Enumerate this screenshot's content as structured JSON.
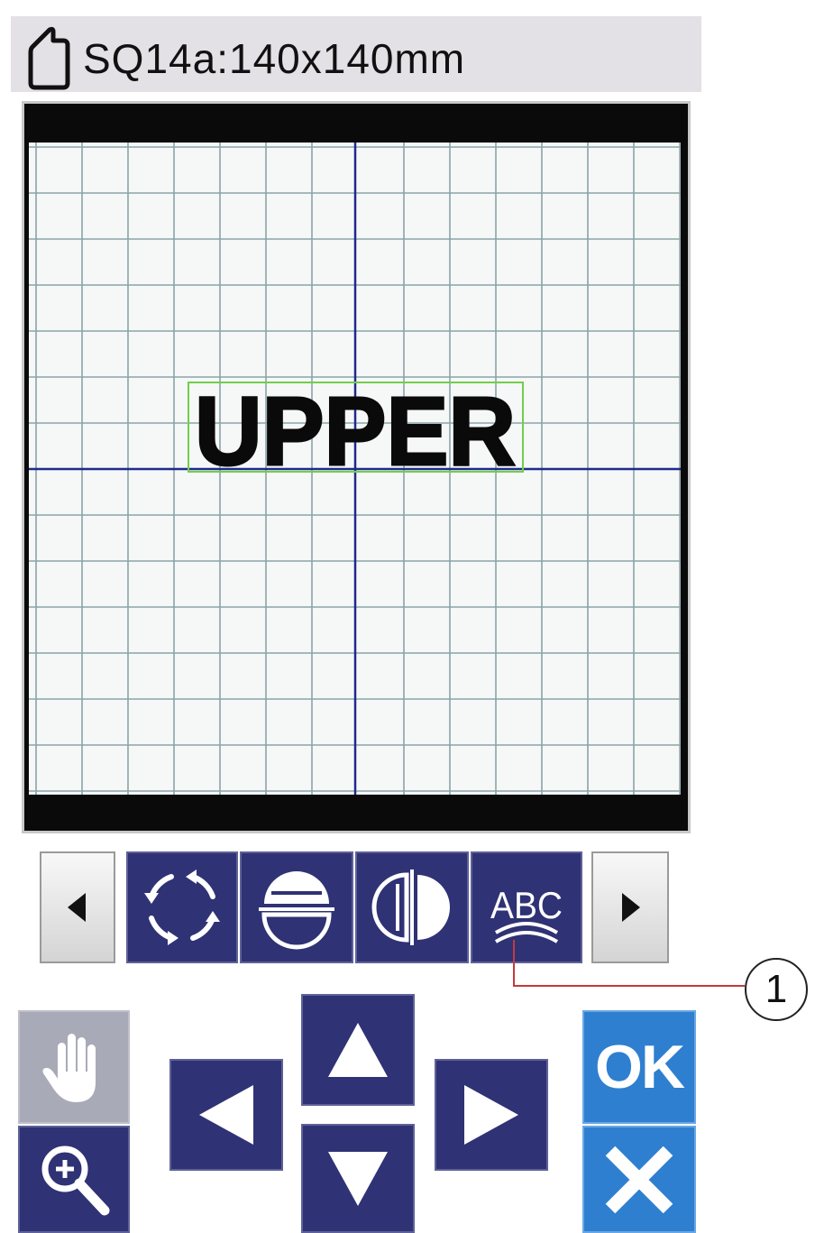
{
  "header": {
    "title": "SQ14a:140x140mm",
    "hoop_icon": "hoop-icon"
  },
  "canvas": {
    "text": "UPPER",
    "grid": "on",
    "colors": {
      "grid_line": "#8aa4a8",
      "center_line": "#1f2a8c",
      "selection_box": "#6fcf4a",
      "frame": "#0a0a0a"
    }
  },
  "toolbar": {
    "buttons": [
      {
        "name": "scroll-left-button",
        "icon": "triangle-left-icon"
      },
      {
        "name": "rotate-button",
        "icon": "rotate-arrows-icon"
      },
      {
        "name": "flip-vertical-button",
        "icon": "flip-vertical-icon"
      },
      {
        "name": "flip-horizontal-button",
        "icon": "flip-horizontal-icon"
      },
      {
        "name": "arc-text-button",
        "icon": "abc-arc-icon"
      },
      {
        "name": "scroll-right-button",
        "icon": "triangle-right-icon"
      }
    ],
    "arc_button_label": "ABC"
  },
  "callout": {
    "number": "1"
  },
  "controls": {
    "hand_icon": "hand-icon",
    "zoom_icon": "zoom-in-icon",
    "arrows": [
      "up-arrow-icon",
      "left-arrow-icon",
      "right-arrow-icon",
      "down-arrow-icon"
    ],
    "ok_label": "OK",
    "cancel_icon": "close-icon"
  },
  "colors": {
    "navy": "#2f3274",
    "ok_blue": "#2f7fd0",
    "disabled": "#a9aab8"
  }
}
